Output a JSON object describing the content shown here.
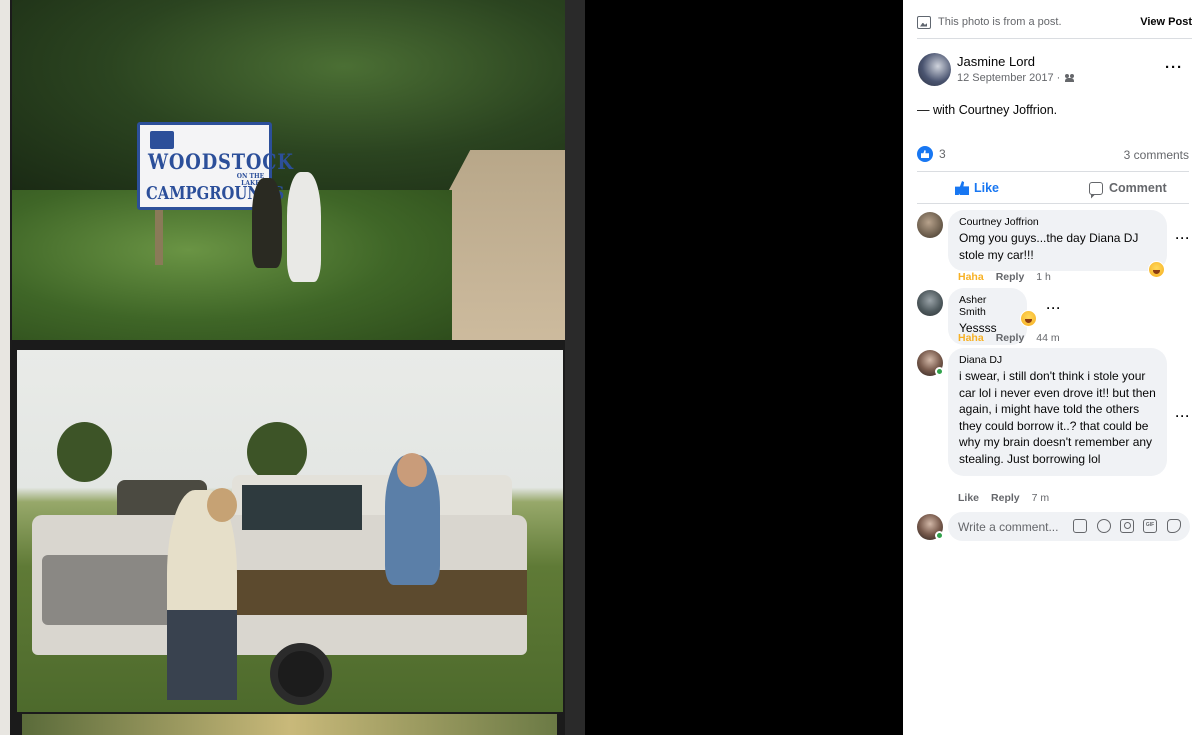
{
  "photo": {
    "sign_text_1": "WOODSTOCK",
    "sign_text_small": "ON THE LAKE",
    "sign_text_2": "CAMPGROUNDS"
  },
  "panel": {
    "notice_text": "This photo is from a post.",
    "view_post_label": "View Post",
    "author": {
      "name": "Jasmine Lord",
      "date": "12 September 2017 ·",
      "privacy_icon": "friends-icon"
    },
    "caption_prefix": "— with ",
    "caption_tag": "Courtney Joffrion",
    "caption_suffix": ".",
    "reaction_count": "3",
    "comment_count": "3 comments",
    "like_label": "Like",
    "comment_label": "Comment",
    "comments": [
      {
        "name": "Courtney Joffrion",
        "text": "Omg you guys...the day Diana DJ stole my car!!!",
        "reaction": "Haha",
        "reply": "Reply",
        "time": "1 h"
      },
      {
        "name": "Asher Smith",
        "text": "Yessss",
        "reaction": "Haha",
        "reply": "Reply",
        "time": "44 m"
      },
      {
        "name": "Diana DJ",
        "text": "i swear, i still don't think i stole your car lol i never even drove it!! but then again, i might have told the others they could borrow it..? that could be why my brain doesn't remember any stealing. Just borrowing lol",
        "reaction": "Like",
        "reply": "Reply",
        "time": "7 m"
      }
    ],
    "write_placeholder": "Write a comment...",
    "gif_label": "GIF"
  },
  "colors": {
    "accent": "#1877f2",
    "haha": "#f7b125",
    "online": "#31a24c",
    "bubble_bg": "#f0f2f5",
    "muted_text": "#65676b"
  }
}
